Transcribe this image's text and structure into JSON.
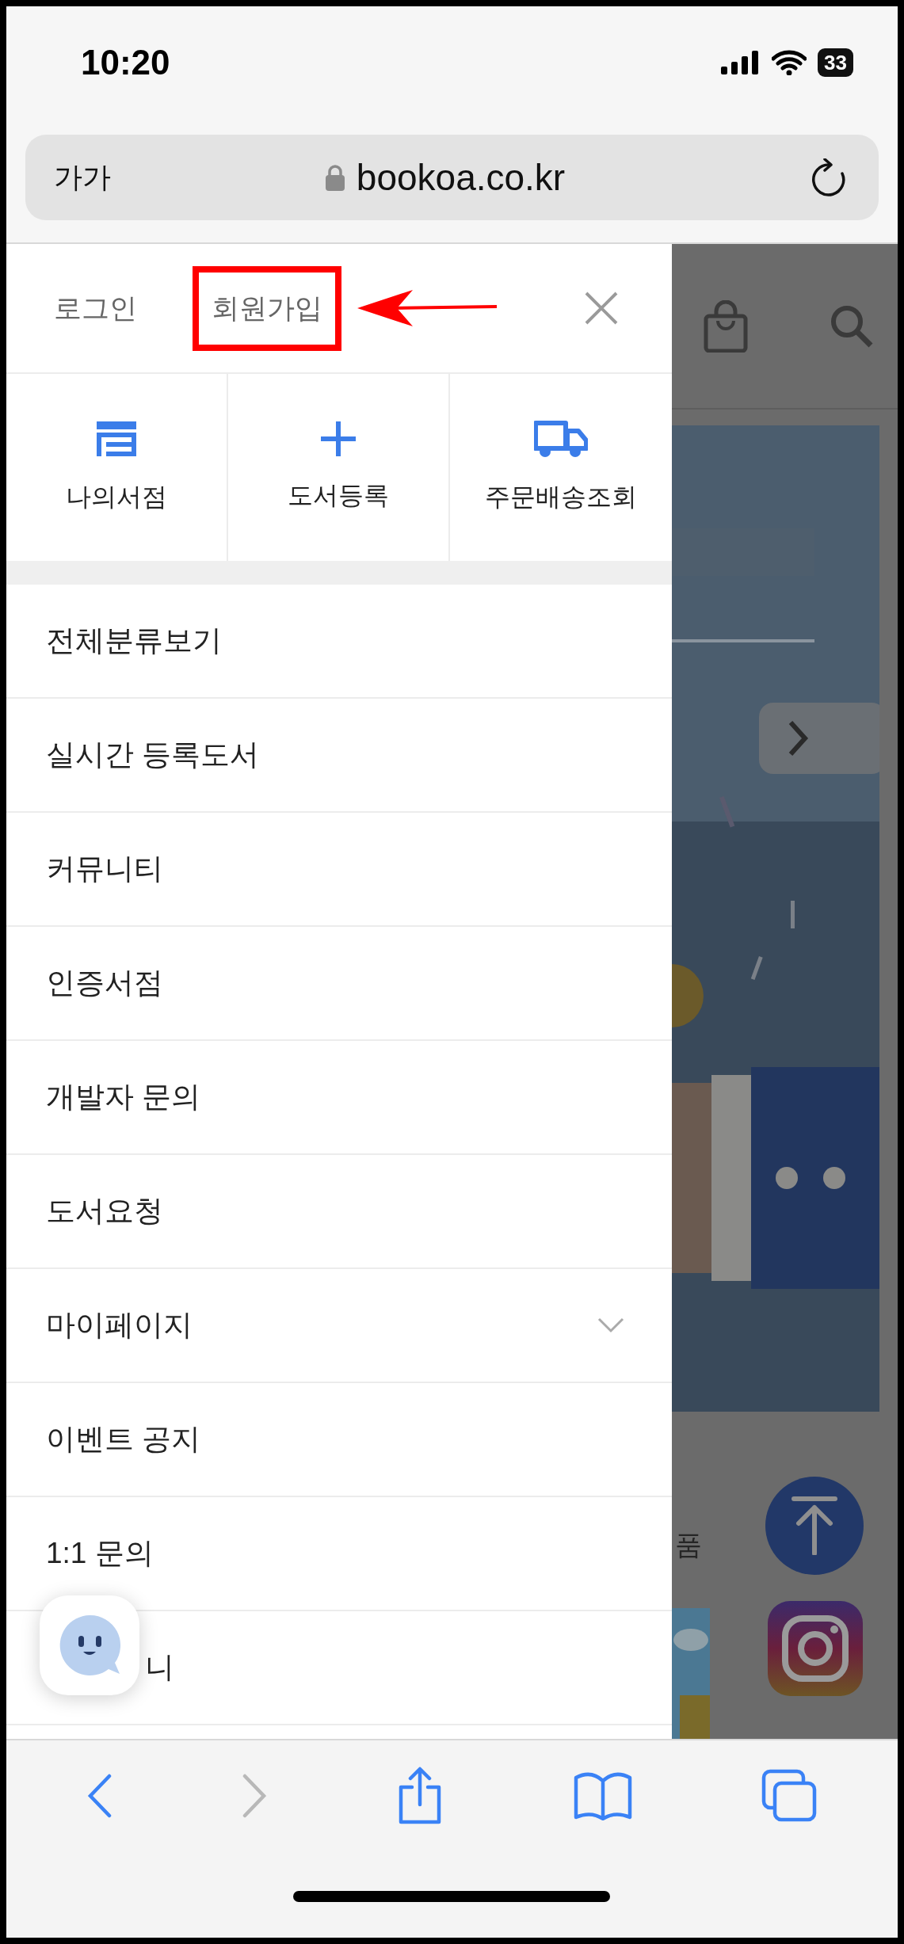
{
  "status_bar": {
    "time": "10:20",
    "battery": "33"
  },
  "address_bar": {
    "text_size_button": "가가",
    "url": "bookoa.co.kr"
  },
  "drawer": {
    "header": {
      "login": "로그인",
      "signup": {
        "label": "회원가입",
        "highlighted": true
      }
    },
    "quick_links": [
      {
        "label": "나의서점",
        "kind": "store"
      },
      {
        "label": "도서등록",
        "kind": "plus"
      },
      {
        "label": "주문배송조회",
        "kind": "truck"
      }
    ],
    "menu": [
      {
        "label": "전체분류보기",
        "kind": "plain"
      },
      {
        "label": "실시간 등록도서",
        "kind": "plain"
      },
      {
        "label": "커뮤니티",
        "kind": "plain"
      },
      {
        "label": "인증서점",
        "kind": "plain"
      },
      {
        "label": "개발자 문의",
        "kind": "plain"
      },
      {
        "label": "도서요청",
        "kind": "plain"
      },
      {
        "label": "마이페이지",
        "kind": "expandable",
        "expanded": false
      },
      {
        "label": "이벤트 공지",
        "kind": "plain"
      },
      {
        "label": "1:1 문의",
        "kind": "plain"
      },
      {
        "label": "니",
        "kind": "covered"
      }
    ]
  },
  "background_page": {
    "section_label": "품"
  },
  "toolbar": [
    {
      "kind": "back",
      "disabled": false
    },
    {
      "kind": "forward",
      "disabled": true
    },
    {
      "kind": "share",
      "disabled": false
    },
    {
      "kind": "bookmarks",
      "disabled": false
    },
    {
      "kind": "tabs",
      "disabled": false
    }
  ]
}
